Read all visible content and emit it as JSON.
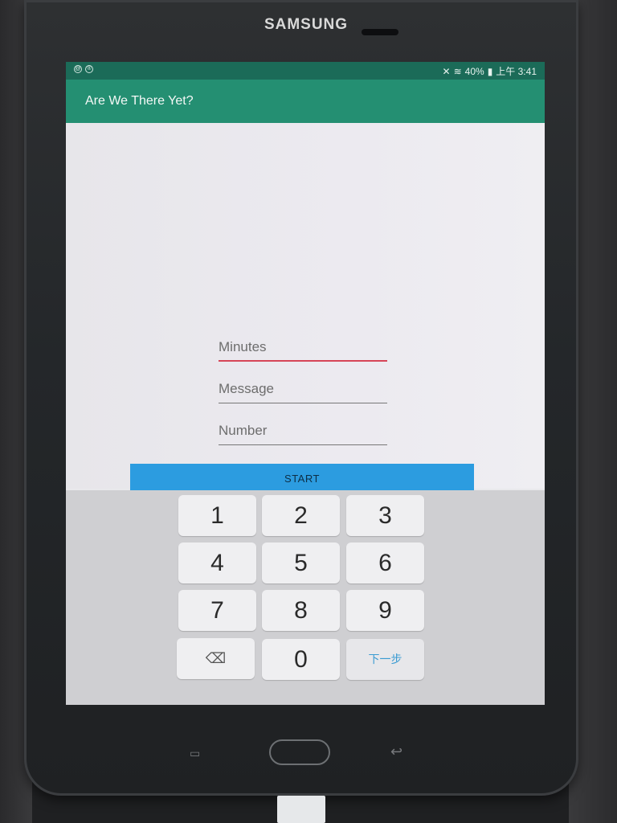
{
  "device": {
    "brand": "SAMSUNG"
  },
  "status_bar": {
    "battery": "40%",
    "time": "上午 3:41"
  },
  "app": {
    "title": "Are We There Yet?"
  },
  "form": {
    "minutes_placeholder": "Minutes",
    "message_placeholder": "Message",
    "number_placeholder": "Number",
    "start_label": "START"
  },
  "keyboard": {
    "keys": [
      "1",
      "2",
      "3",
      "4",
      "5",
      "6",
      "7",
      "8",
      "9",
      "0"
    ],
    "next_label": "下一步"
  },
  "colors": {
    "status_bar": "#1b6b58",
    "app_bar": "#248f72",
    "start_button": "#2c9ce0",
    "focus_underline": "#d64557"
  }
}
